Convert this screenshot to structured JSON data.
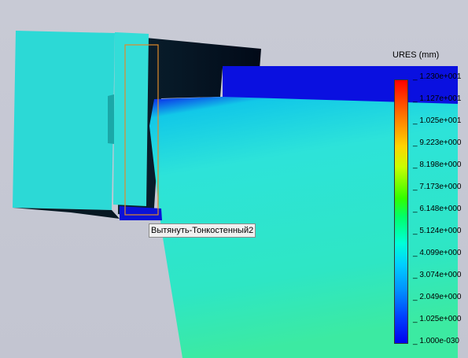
{
  "legend": {
    "title": "URES (mm)",
    "ticks": [
      "1.230e+001",
      "1.127e+001",
      "1.025e+001",
      "9.223e+000",
      "8.198e+000",
      "7.173e+000",
      "6.148e+000",
      "5.124e+000",
      "4.099e+000",
      "3.074e+000",
      "2.049e+000",
      "1.025e+000",
      "1.000e-030"
    ]
  },
  "tooltip": {
    "text": "Вытянуть-Тонкостенный2"
  },
  "colors": {
    "background": "#c5c7d2",
    "cyan": "#2fe0d9",
    "blue": "#0a10e0",
    "dark": "#05121e",
    "highlight": "#e08a2a"
  }
}
